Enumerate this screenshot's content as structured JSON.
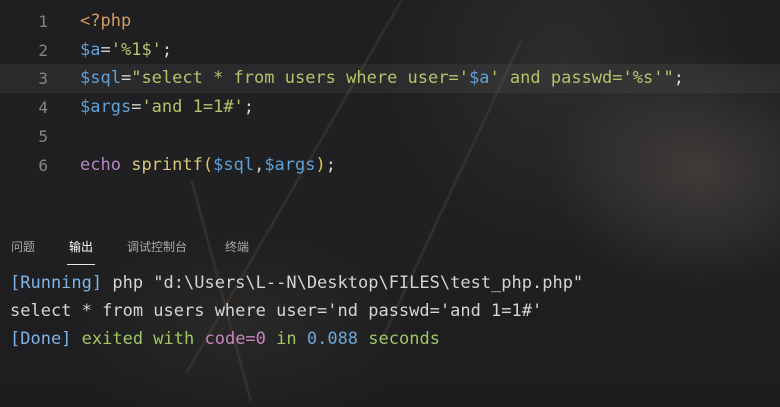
{
  "editor": {
    "lines": [
      {
        "num": "1",
        "tokens": [
          "<?php"
        ]
      },
      {
        "num": "2",
        "tokens": [
          "$a",
          "=",
          "'%1$'",
          ";"
        ]
      },
      {
        "num": "3",
        "tokens": [
          "$sql",
          "=",
          "\"select * from users where user='",
          "$a",
          "' and passwd='%s'\"",
          ";"
        ]
      },
      {
        "num": "4",
        "tokens": [
          "$args",
          "=",
          "'and 1=1#'",
          ";"
        ]
      },
      {
        "num": "5",
        "tokens": []
      },
      {
        "num": "6",
        "tokens": [
          "echo",
          " ",
          "sprintf",
          "(",
          "$sql",
          ",",
          "$args",
          ")",
          ";"
        ]
      }
    ]
  },
  "panel": {
    "tabs": [
      "问题",
      "输出",
      "调试控制台",
      "终端"
    ],
    "active_tab": "输出",
    "output": {
      "line1": {
        "tag": "[Running]",
        "text": " php \"d:\\Users\\L--N\\Desktop\\FILES\\test_php.php\""
      },
      "line2": "select * from users where user='nd passwd='and 1=1#'",
      "line3": {
        "tag": "[Done]",
        "exited": " exited with ",
        "code": "code=0",
        "in": " in ",
        "time": "0.088",
        "seconds": " seconds"
      }
    }
  }
}
